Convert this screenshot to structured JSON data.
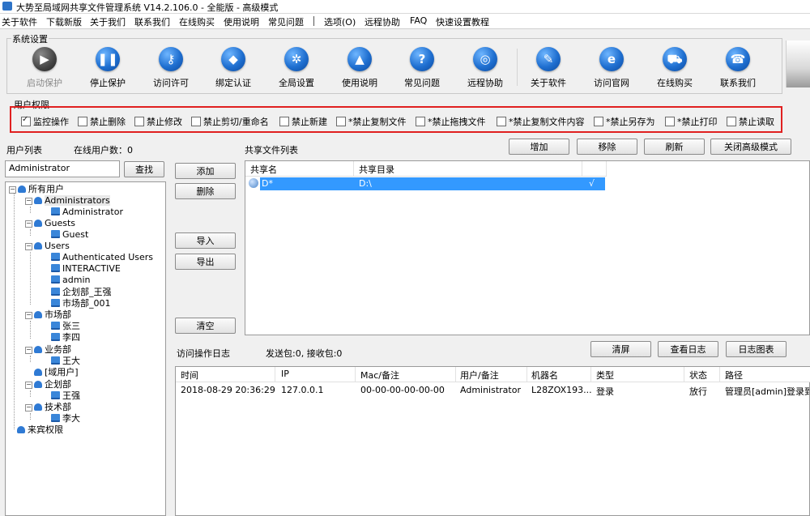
{
  "window": {
    "title": "大势至局域网共享文件管理系统 V14.2.106.0 - 全能版 - 高级模式"
  },
  "menu": [
    "关于软件",
    "下载新版",
    "关于我们",
    "联系我们",
    "在线购买",
    "使用说明",
    "常见问题",
    "选项(O)",
    "远程协助",
    "FAQ",
    "快速设置教程"
  ],
  "toolbar": {
    "group_title": "系统设置",
    "buttons": [
      {
        "label": "启动保护",
        "icon": "play-icon",
        "disabled": true
      },
      {
        "label": "停止保护",
        "icon": "pause-icon"
      },
      {
        "label": "访问许可",
        "icon": "key-icon"
      },
      {
        "label": "绑定认证",
        "icon": "shield-icon"
      },
      {
        "label": "全局设置",
        "icon": "gear-icon"
      },
      {
        "label": "使用说明",
        "icon": "graduation-cap-icon"
      },
      {
        "label": "常见问题",
        "icon": "question-icon"
      },
      {
        "label": "远程协助",
        "icon": "globe-icon"
      },
      {
        "label": "关于软件",
        "icon": "document-icon"
      },
      {
        "label": "访问官网",
        "icon": "ie-browser-icon"
      },
      {
        "label": "在线购买",
        "icon": "cart-icon"
      },
      {
        "label": "联系我们",
        "icon": "phone-icon"
      }
    ]
  },
  "permissions": {
    "group_title": "用户权限",
    "items": [
      {
        "label": "监控操作",
        "checked": true
      },
      {
        "label": "禁止删除",
        "checked": false
      },
      {
        "label": "禁止修改",
        "checked": false
      },
      {
        "label": "禁止剪切/重命名",
        "checked": false
      },
      {
        "label": "禁止新建",
        "checked": false
      },
      {
        "label": "*禁止复制文件",
        "checked": false
      },
      {
        "label": "*禁止拖拽文件",
        "checked": false
      },
      {
        "label": "*禁止复制文件内容",
        "checked": false
      },
      {
        "label": "*禁止另存为",
        "checked": false
      },
      {
        "label": "*禁止打印",
        "checked": false
      },
      {
        "label": "禁止读取",
        "checked": false
      }
    ]
  },
  "users": {
    "list_title": "用户列表",
    "online_label": "在线用户数：0",
    "search_value": "Administrator",
    "search_button": "查找",
    "tree": {
      "root": "所有用户",
      "groups": [
        {
          "name": "Administrators",
          "members": [
            "Administrator"
          ]
        },
        {
          "name": "Guests",
          "members": [
            "Guest"
          ]
        },
        {
          "name": "Users",
          "members": [
            "Authenticated Users",
            "INTERACTIVE",
            "admin",
            "企划部_王强",
            "市场部_001"
          ]
        },
        {
          "name": "市场部",
          "members": [
            "张三",
            "李四"
          ]
        },
        {
          "name": "业务部",
          "members": [
            "王大"
          ]
        },
        {
          "name": "[域用户]",
          "members": []
        },
        {
          "name": "企划部",
          "members": [
            "王强"
          ]
        },
        {
          "name": "技术部",
          "members": [
            "李大"
          ]
        },
        {
          "name": "来宾权限",
          "members": []
        }
      ]
    }
  },
  "actions": {
    "add": "添加",
    "delete": "删除",
    "import": "导入",
    "export": "导出",
    "clear": "清空"
  },
  "shares": {
    "title": "共享文件列表",
    "buttons": {
      "add": "增加",
      "remove": "移除",
      "refresh": "刷新",
      "advanced": "关闭高级模式"
    },
    "columns": [
      "共享名",
      "共享目录"
    ],
    "rows": [
      {
        "name": "D*",
        "path": "D:\\",
        "check": "√"
      }
    ]
  },
  "log": {
    "title": "访问操作日志",
    "stats": "发送包:0, 接收包:0",
    "buttons": {
      "clear": "清屏",
      "view": "查看日志",
      "chart": "日志图表"
    },
    "columns": [
      "时间",
      "IP",
      "Mac/备注",
      "用户/备注",
      "机器名",
      "类型",
      "状态",
      "路径"
    ],
    "rows": [
      {
        "time": "2018-08-29 20:36:29",
        "ip": "127.0.0.1",
        "mac": "00-00-00-00-00-00",
        "user": "Administrator",
        "machine": "L28ZOX193...",
        "type": "登录",
        "status": "放行",
        "path": "管理员[admin]登录到本"
      }
    ]
  }
}
